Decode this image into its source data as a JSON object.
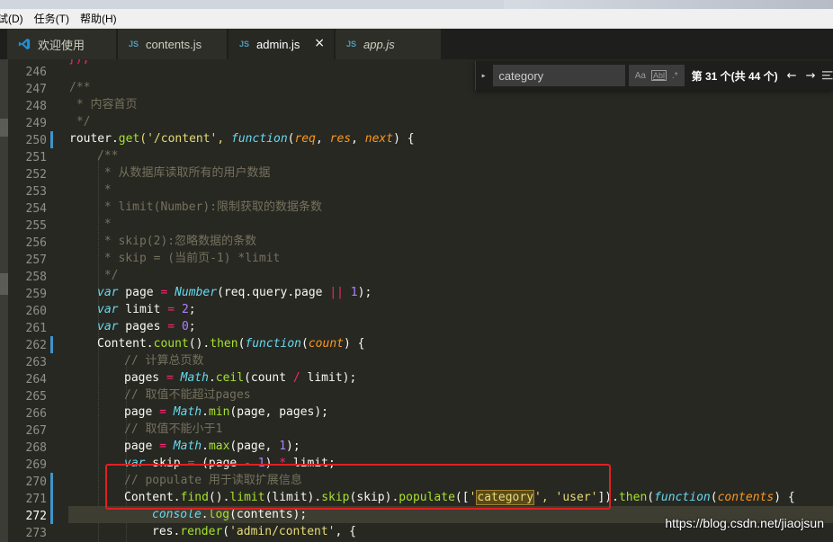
{
  "menubar": {
    "items": [
      "试(D)",
      "任务(T)",
      "帮助(H)"
    ]
  },
  "tabs": [
    {
      "label": "欢迎使用",
      "icon": "vscode-logo-icon",
      "active": false
    },
    {
      "label": "contents.js",
      "icon": "JS",
      "active": false
    },
    {
      "label": "admin.js",
      "icon": "JS",
      "active": true,
      "close": "×"
    },
    {
      "label": "app.js",
      "icon": "JS",
      "active": false,
      "preview": true
    }
  ],
  "find": {
    "query": "category",
    "match_case": "Aa",
    "whole_word": "Abl",
    "regex": ".*",
    "count": "第 31 个(共 44 个)",
    "prev": "←",
    "next": "→"
  },
  "watermark": "https://blog.csdn.net/jiaojsun",
  "editor": {
    "current_line": 272,
    "lines": [
      {
        "n": "246"
      },
      {
        "n": "247"
      },
      {
        "n": "248"
      },
      {
        "n": "249"
      },
      {
        "n": "250"
      },
      {
        "n": "251"
      },
      {
        "n": "252"
      },
      {
        "n": "253"
      },
      {
        "n": "254"
      },
      {
        "n": "255"
      },
      {
        "n": "256"
      },
      {
        "n": "257"
      },
      {
        "n": "258"
      },
      {
        "n": "259"
      },
      {
        "n": "260"
      },
      {
        "n": "261"
      },
      {
        "n": "262"
      },
      {
        "n": "263"
      },
      {
        "n": "264"
      },
      {
        "n": "265"
      },
      {
        "n": "266"
      },
      {
        "n": "267"
      },
      {
        "n": "268"
      },
      {
        "n": "269"
      },
      {
        "n": "270"
      },
      {
        "n": "271"
      },
      {
        "n": "272"
      },
      {
        "n": "273"
      }
    ],
    "code": {
      "l247": "/**",
      "l248": " * 内容首页",
      "l249": " */",
      "l250_a": "router",
      "l250_b": ".",
      "l250_c": "get",
      "l250_d": "('/content', ",
      "l250_e": "function",
      "l250_f": "(",
      "l250_g": "req",
      "l250_h": ", ",
      "l250_i": "res",
      "l250_j": ", ",
      "l250_k": "next",
      "l250_l": ") {",
      "l251": "/**",
      "l252": " * 从数据库读取所有的用户数据",
      "l253": " *",
      "l254": " * limit(Number):限制获取的数据条数",
      "l255": " *",
      "l256": " * skip(2):忽略数据的条数",
      "l257": " * skip = (当前页-1) *limit",
      "l258": " */",
      "l259_a": "var",
      "l259_b": " page ",
      "l259_c": "=",
      "l259_d": " ",
      "l259_e": "Number",
      "l259_f": "(req.query.page ",
      "l259_g": "||",
      "l259_h": " ",
      "l259_i": "1",
      "l259_j": ");",
      "l260_a": "var",
      "l260_b": " limit ",
      "l260_c": "=",
      "l260_d": " ",
      "l260_e": "2",
      "l260_f": ";",
      "l261_a": "var",
      "l261_b": " pages ",
      "l261_c": "=",
      "l261_d": " ",
      "l261_e": "0",
      "l261_f": ";",
      "l262_a": "Content.",
      "l262_b": "count",
      "l262_c": "().",
      "l262_d": "then",
      "l262_e": "(",
      "l262_f": "function",
      "l262_g": "(",
      "l262_h": "count",
      "l262_i": ") {",
      "l263": "// 计算总页数",
      "l264_a": "pages ",
      "l264_b": "=",
      "l264_c": " ",
      "l264_d": "Math",
      "l264_e": ".",
      "l264_f": "ceil",
      "l264_g": "(count ",
      "l264_h": "/",
      "l264_i": " limit);",
      "l265": "// 取值不能超过pages",
      "l266_a": "page ",
      "l266_b": "=",
      "l266_c": " ",
      "l266_d": "Math",
      "l266_e": ".",
      "l266_f": "min",
      "l266_g": "(page, pages);",
      "l267": "// 取值不能小于1",
      "l268_a": "page ",
      "l268_b": "=",
      "l268_c": " ",
      "l268_d": "Math",
      "l268_e": ".",
      "l268_f": "max",
      "l268_g": "(page, ",
      "l268_h": "1",
      "l268_i": ");",
      "l269_a": "var",
      "l269_b": " skip ",
      "l269_c": "=",
      "l269_d": " (page ",
      "l269_e": "-",
      "l269_f": " ",
      "l269_g": "1",
      "l269_h": ") ",
      "l269_i": "*",
      "l269_j": " limit;",
      "l270": "// populate 用于读取扩展信息",
      "l271_a": "Content.",
      "l271_b": "find",
      "l271_c": "().",
      "l271_d": "limit",
      "l271_e": "(limit).",
      "l271_f": "skip",
      "l271_g": "(skip).",
      "l271_h": "populate",
      "l271_i": "([",
      "l271_j": "'",
      "l271_k": "category",
      "l271_l": "', ",
      "l271_m": "'user'",
      "l271_n": "]).",
      "l271_o": "then",
      "l271_p": "(",
      "l271_q": "function",
      "l271_r": "(",
      "l271_s": "contents",
      "l271_t": ") {",
      "l272_a": "console",
      "l272_b": ".",
      "l272_c": "log",
      "l272_d": "(contents);",
      "l273_a": "res.",
      "l273_b": "render",
      "l273_c": "(",
      "l273_d": "'admin/content'",
      "l273_e": ", {"
    }
  }
}
